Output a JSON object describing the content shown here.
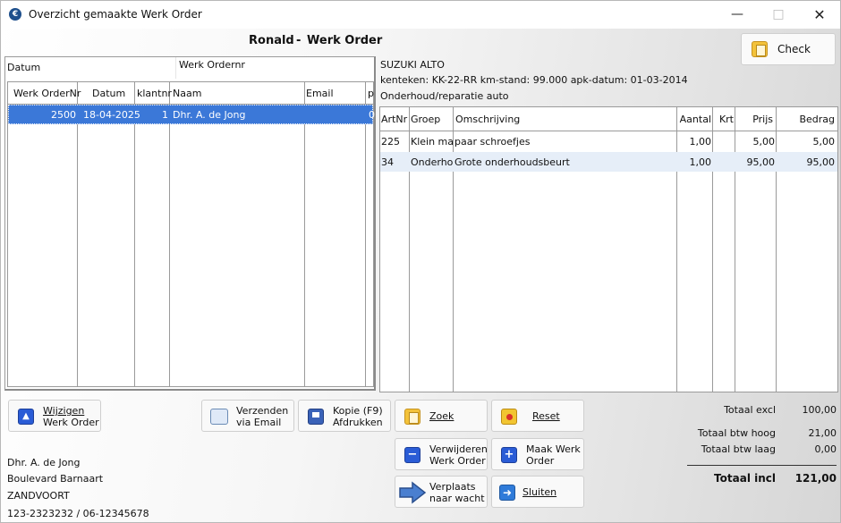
{
  "window": {
    "title": "Overzicht gemaakte Werk Order"
  },
  "header": {
    "name": "Ronald",
    "separator": "-",
    "heading": "Werk Order"
  },
  "check_button": {
    "label": "Check"
  },
  "left": {
    "datum_label": "Datum",
    "werkordernr_label": "Werk Ordernr",
    "columns": [
      "Werk OrderNr",
      "Datum",
      "klantnr",
      "Naam",
      "Email",
      "p"
    ],
    "rows": [
      {
        "order": "2500",
        "datum": "18-04-2025",
        "klantnr": "1",
        "naam": "Dhr. A. de Jong",
        "email": "",
        "p": "0"
      }
    ]
  },
  "vehicle": {
    "model": "SUZUKI ALTO",
    "details": "kenteken: KK-22-RR  km-stand: 99.000  apk-datum: 01-03-2014",
    "type": "Onderhoud/reparatie auto"
  },
  "right": {
    "columns": [
      "ArtNr",
      "Groep",
      "Omschrijving",
      "Aantal",
      "Krt",
      "Prijs",
      "Bedrag"
    ],
    "rows": [
      {
        "artnr": "225",
        "groep": "Klein mate",
        "omschrijving": "paar schroefjes",
        "aantal": "1,00",
        "krt": "",
        "prijs": "5,00",
        "bedrag": "5,00"
      },
      {
        "artnr": "34",
        "groep": "Onderhou",
        "omschrijving": "Grote onderhoudsbeurt",
        "aantal": "1,00",
        "krt": "",
        "prijs": "95,00",
        "bedrag": "95,00"
      }
    ]
  },
  "buttons": {
    "wijzigen": [
      "Wijzigen",
      "Werk Order"
    ],
    "verzenden": [
      "Verzenden",
      "via Email"
    ],
    "kopie": [
      "Kopie (F9)",
      "Afdrukken"
    ],
    "zoek": "Zoek",
    "reset": "Reset",
    "verwijderen": [
      "Verwijderen",
      "Werk Order"
    ],
    "maak": [
      "Maak Werk",
      "Order"
    ],
    "verplaats": [
      "Verplaats",
      "naar wacht"
    ],
    "sluiten": "Sluiten"
  },
  "totals": {
    "excl_label": "Totaal excl",
    "excl_value": "100,00",
    "hoog_label": "Totaal btw hoog",
    "hoog_value": "21,00",
    "laag_label": "Totaal btw laag",
    "laag_value": "0,00",
    "incl_label": "Totaal incl",
    "incl_value": "121,00"
  },
  "customer": {
    "name": "Dhr. A. de Jong",
    "street": "Boulevard Barnaart",
    "city": "ZANDVOORT",
    "phone": "123-2323232 / 06-12345678"
  },
  "colors": {
    "selection": "#3b78d8",
    "alt_row": "#e6eef8",
    "accent_blue": "#2a5cd6",
    "folder_yellow": "#f3c23a"
  }
}
